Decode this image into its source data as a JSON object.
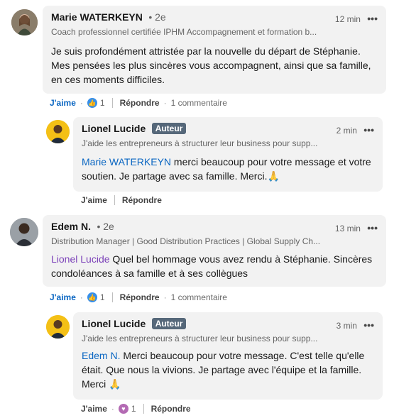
{
  "comments": [
    {
      "name": "Marie WATERKEYN",
      "degree": "• 2e",
      "headline": "Coach professionnel certifiée IPHM Accompagnement et formation b...",
      "time": "12 min",
      "more": "•••",
      "text": "Je suis profondément attristée par la nouvelle du départ de Stéphanie. Mes pensées les plus sincères vous accompagnent, ainsi que sa famille, en ces moments difficiles.",
      "like_label": "J'aime",
      "reaction_count": "1",
      "reply_label": "Répondre",
      "replies_label": "1 commentaire"
    },
    {
      "name": "Lionel Lucide",
      "badge": "Auteur",
      "headline": "J'aide les entrepreneurs à structurer leur business pour supp...",
      "time": "2 min",
      "more": "•••",
      "mention": "Marie WATERKEYN",
      "text": " merci beaucoup pour votre message et votre soutien. Je partage avec sa famille. Merci.🙏",
      "like_label": "J'aime",
      "reply_label": "Répondre"
    },
    {
      "name": "Edem N.",
      "degree": "• 2e",
      "headline": "Distribution Manager | Good Distribution Practices | Global Supply Ch...",
      "time": "13 min",
      "more": "•••",
      "mention": "Lionel Lucide",
      "text": " Quel bel hommage vous avez rendu à Stéphanie. Sincères condoléances à sa famille et à ses collègues",
      "like_label": "J'aime",
      "reaction_count": "1",
      "reply_label": "Répondre",
      "replies_label": "1 commentaire"
    },
    {
      "name": "Lionel Lucide",
      "badge": "Auteur",
      "headline": "J'aide les entrepreneurs à structurer leur business pour supp...",
      "time": "3 min",
      "more": "•••",
      "mention": "Edem N.",
      "text": " Merci beaucoup pour votre message. C'est telle qu'elle était. Que nous la vivions. Je partage avec l'équipe et la famille. Merci 🙏",
      "like_label": "J'aime",
      "reaction_count": "1",
      "reply_label": "Répondre"
    }
  ]
}
